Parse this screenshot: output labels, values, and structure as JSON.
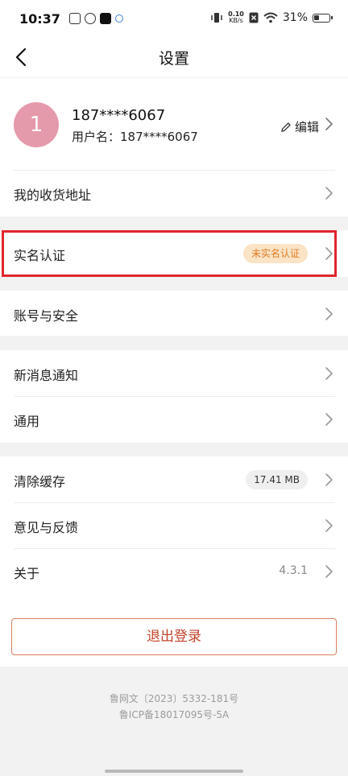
{
  "status_bar": {
    "time": "10:37",
    "net_speed_value": "0.10",
    "net_speed_unit": "KB/s",
    "battery": "31%"
  },
  "header": {
    "title": "设置"
  },
  "profile": {
    "avatar_initial": "1",
    "phone": "187****6067",
    "username": "用户名：187****6067",
    "edit_label": "编辑"
  },
  "rows": {
    "address": "我的收货地址",
    "real_name": "实名认证",
    "real_name_status": "未实名认证",
    "account_security": "账号与安全",
    "notifications": "新消息通知",
    "general": "通用",
    "clear_cache": "清除缓存",
    "cache_size": "17.41 MB",
    "feedback": "意见与反馈",
    "about": "关于",
    "version": "4.3.1"
  },
  "logout_label": "退出登录",
  "footer": {
    "license": "鲁网文〔2023〕5332-181号",
    "icp": "鲁ICP备18017095号-5A"
  },
  "colors": {
    "highlight": "#e0262d",
    "badge_orange_bg": "#fbe3c6",
    "badge_orange_text": "#e07e25",
    "logout_text": "#c4432b",
    "avatar": "#e59aab"
  }
}
